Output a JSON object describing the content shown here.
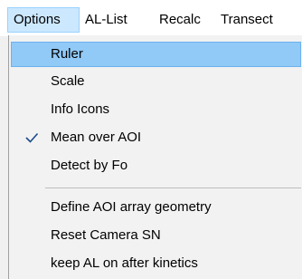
{
  "menubar": {
    "items": [
      {
        "label": "Options"
      },
      {
        "label": "AL-List"
      },
      {
        "label": "Recalc"
      },
      {
        "label": "Transect"
      }
    ]
  },
  "menu": {
    "items": [
      {
        "label": "Ruler",
        "state": "highlighted"
      },
      {
        "label": "Scale"
      },
      {
        "label": "Info Icons"
      },
      {
        "label": "Mean over AOI",
        "checked": true
      },
      {
        "label": "Detect by Fo"
      },
      {
        "label": "Define AOI array geometry"
      },
      {
        "label": "Reset Camera SN"
      },
      {
        "label": "keep AL on after kinetics"
      }
    ]
  },
  "colors": {
    "highlight": "#91c9f7",
    "menubar_active": "#cce8ff",
    "check": "#1a4a8a"
  }
}
